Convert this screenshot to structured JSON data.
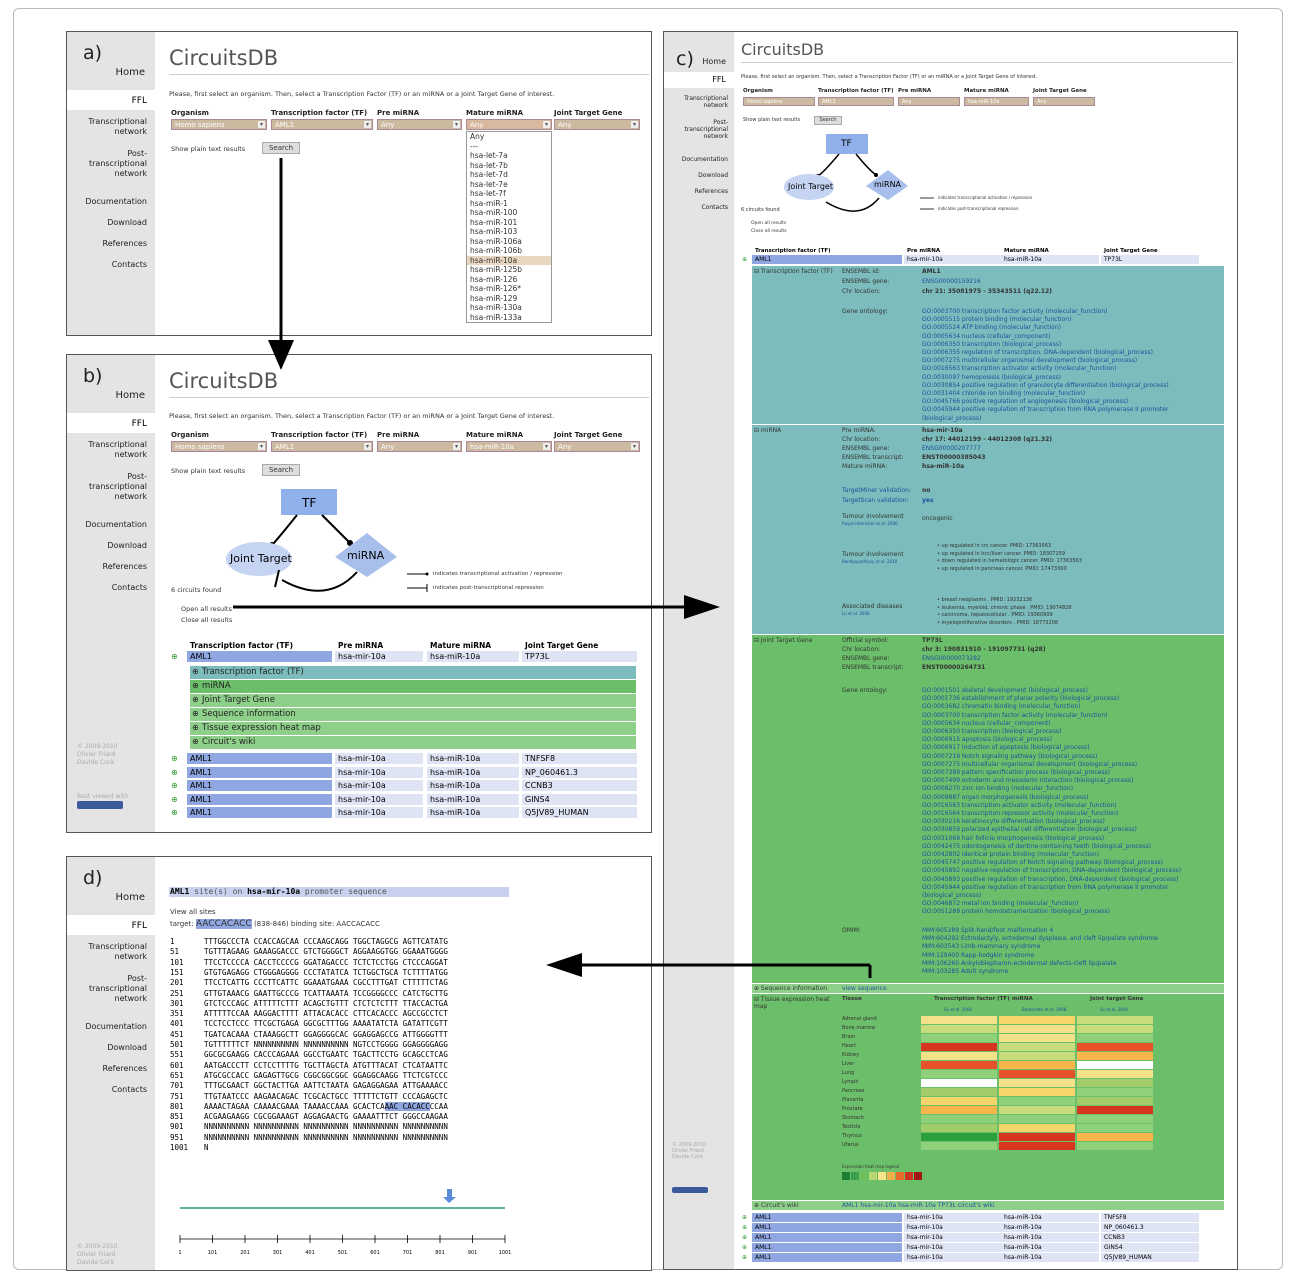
{
  "brand": "CircuitsDB",
  "panels": {
    "a": "a)",
    "b": "b)",
    "c": "c)",
    "d": "d)"
  },
  "nav": {
    "home": "Home",
    "ffl": "FFL",
    "tn": "Transcriptional network",
    "ptn": "Post-transcriptional network",
    "doc": "Documentation",
    "dl": "Download",
    "ref": "References",
    "contacts": "Contacts"
  },
  "intro": "Please, first select an organism. Then, select a Transcription Factor (TF) or an miRNA or a Joint Target Gene of interest.",
  "form": {
    "organism_h": "Organism",
    "tf_h": "Transcription factor (TF)",
    "pre_h": "Pre miRNA",
    "mature_h": "Mature miRNA",
    "jtg_h": "Joint Target Gene",
    "organism": "Homo sapiens",
    "tf": "AML1",
    "pre": "Any",
    "mature_any": "Any",
    "mature_sel": "hsa-miR-10a",
    "jtg": "Any",
    "plain": "Show plain text results",
    "search": "Search"
  },
  "dropdown": [
    "Any",
    "---",
    "hsa-let-7a",
    "hsa-let-7b",
    "hsa-let-7d",
    "hsa-let-7e",
    "hsa-let-7f",
    "hsa-miR-1",
    "hsa-miR-100",
    "hsa-miR-101",
    "hsa-miR-103",
    "hsa-miR-106a",
    "hsa-miR-106b",
    "hsa-miR-10a",
    "hsa-miR-125b",
    "hsa-miR-126",
    "hsa-miR-126*",
    "hsa-miR-129",
    "hsa-miR-130a",
    "hsa-miR-133a"
  ],
  "diagram": {
    "tf": "TF",
    "jt": "Joint Target",
    "mirna": "miRNA",
    "leg1": "indicates transcriptional activation / repression",
    "leg2": "indicates post-transcriptional repression"
  },
  "results": {
    "found": "6 circuits found",
    "open": "Open all results",
    "close": "Close all results",
    "cols": [
      "Transcription factor (TF)",
      "Pre miRNA",
      "Mature miRNA",
      "Joint Target Gene"
    ],
    "first": [
      "AML1",
      "hsa-mir-10a",
      "hsa-miR-10a",
      "TP73L"
    ],
    "sections": [
      "Transcription factor (TF)",
      "miRNA",
      "Joint Target Gene",
      "Sequence information",
      "Tissue expression heat map",
      "Circuit's wiki"
    ],
    "rows": [
      [
        "AML1",
        "hsa-mir-10a",
        "hsa-miR-10a",
        "TNFSF8"
      ],
      [
        "AML1",
        "hsa-mir-10a",
        "hsa-miR-10a",
        "NP_060461.3"
      ],
      [
        "AML1",
        "hsa-mir-10a",
        "hsa-miR-10a",
        "CCNB3"
      ],
      [
        "AML1",
        "hsa-mir-10a",
        "hsa-miR-10a",
        "GINS4"
      ],
      [
        "AML1",
        "hsa-mir-10a",
        "hsa-miR-10a",
        "Q5JV89_HUMAN"
      ]
    ]
  },
  "footer": {
    "copy": "© 2009-2010",
    "a1": "Olivier Friard",
    "a2": "Davide Corà",
    "best": "Best viewed with"
  },
  "detail": {
    "tf_label": "Transcription factor (TF)",
    "tf": [
      [
        "ENSEMBL id:",
        "AML1"
      ],
      [
        "ENSEMBL gene:",
        "ENSG00000159216"
      ],
      [
        "Chr location:",
        "chr 21: 35081975 - 35343511 (q22.12)"
      ]
    ],
    "go_label": "Gene ontology:",
    "tf_go": [
      "GO:0003700 transcription factor activity (molecular_function)",
      "GO:0005515 protein binding (molecular_function)",
      "GO:0005524 ATP binding (molecular_function)",
      "GO:0005634 nucleus (cellular_component)",
      "GO:0006350 transcription (biological_process)",
      "GO:0006355 regulation of transcription, DNA-dependent (biological_process)",
      "GO:0007275 multicellular organismal development (biological_process)",
      "GO:0016563 transcription activator activity (molecular_function)",
      "GO:0030097 hemopoiesis (biological_process)",
      "GO:0030854 positive regulation of granulocyte differentiation (biological_process)",
      "GO:0031404 chloride ion binding (molecular_function)",
      "GO:0045766 positive regulation of angiogenesis (biological_process)",
      "GO:0045944 positive regulation of transcription from RNA polymerase II promoter",
      "(biological_process)"
    ],
    "mi_label": "miRNA",
    "mi": [
      [
        "Pre miRNA:",
        "hsa-mir-10a"
      ],
      [
        "Chr location:",
        "chr 17: 44012199 - 44012308 (q21.32)"
      ],
      [
        "ENSEMBL gene:",
        "ENSG00000207777"
      ],
      [
        "ENSEMBL transcript:",
        "ENST00000385043"
      ],
      [
        "Mature miRNA:",
        "hsa-miR-10a"
      ]
    ],
    "tm": [
      "TargetMiner validation:",
      "no"
    ],
    "ts": [
      "TargetScan validation:",
      "yes"
    ],
    "tumour": "Tumour involvement",
    "onco": "oncogenic",
    "ref1": "Rayani-Kemcher et al. 2006",
    "tumour2": "Tumour involvement",
    "ref2": "Bandyopadhyay et al. 2010",
    "tum_list": [
      "up regulated in crc cancer. PMID: 17363563",
      "up regulated in hcc/liver cancer. PMID: 18307259",
      "down regulated in hematologic cancer. PMID: 17363563",
      "up regulated in pancreas cancer. PMID: 17473300"
    ],
    "assoc": "Associated diseases",
    "ref3": "Lu et al. 2008",
    "dis_list": [
      "breast neoplasms . PMID: 19232136",
      "leukemia, myeloid, chronic phase . PMID: 19074828",
      "carcinoma, hepatocellular . PMID: 19360909",
      "myeloproliferative disorders . PMID: 18773208"
    ],
    "jtg_label": "Joint Target Gene",
    "jtg": [
      [
        "Official symbol:",
        "TP73L"
      ],
      [
        "Chr location:",
        "chr 3: 190831910 - 191097731 (q28)"
      ],
      [
        "ENSEMBL gene:",
        "ENSG00000073282"
      ],
      [
        "ENSEMBL transcript:",
        "ENST00000264731"
      ]
    ],
    "jtg_go": [
      "GO:0001501 skeletal development (biological_process)",
      "GO:0001736 establishment of planar polarity (biological_process)",
      "GO:0003682 chromatin binding (molecular_function)",
      "GO:0003700 transcription factor activity (molecular_function)",
      "GO:0005634 nucleus (cellular_component)",
      "GO:0006350 transcription (biological_process)",
      "GO:0006915 apoptosis (biological_process)",
      "GO:0006917 induction of apoptosis (biological_process)",
      "GO:0007219 Notch signaling pathway (biological_process)",
      "GO:0007275 multicellular organismal development (biological_process)",
      "GO:0007389 pattern specification process (biological_process)",
      "GO:0007499 ectoderm and mesoderm interaction (biological_process)",
      "GO:0008270 zinc ion binding (molecular_function)",
      "GO:0009887 organ morphogenesis (biological_process)",
      "GO:0016563 transcription activator activity (molecular_function)",
      "GO:0016564 transcription repressor activity (molecular_function)",
      "GO:0030216 keratinocyte differentiation (biological_process)",
      "GO:0030859 polarized epithelial cell differentiation (biological_process)",
      "GO:0031069 hair follicle morphogenesis (biological_process)",
      "GO:0042475 odontogenesis of dentine-containing teeth (biological_process)",
      "GO:0042802 identical protein binding (molecular_function)",
      "GO:0045747 positive regulation of Notch signaling pathway (biological_process)",
      "GO:0045892 negative regulation of transcription, DNA-dependent (biological_process)",
      "GO:0045893 positive regulation of transcription, DNA-dependent (biological_process)",
      "GO:0045944 positive regulation of transcription from RNA polymerase II promoter",
      "(biological_process)",
      "GO:0046872 metal ion binding (molecular_function)",
      "GO:0051289 protein homotetramerization (biological_process)"
    ],
    "omim_label": "OMIM:",
    "omim": [
      "MIM:605289 Split-hand/foot malformation 4",
      "MIM:604292 Ectrodactyly, ectodermal dysplasia, and cleft lip/palate syndrome",
      "MIM:603543 Limb-mammary syndrome",
      "MIM:129400 Rapp-hodgkin syndrome",
      "MIM:106260 Ankyloblepharon-ectodermal defects-cleft lip/palate",
      "MIM:103285 Adult syndrome"
    ],
    "seq_label": "Sequence information",
    "seq_link": "view sequence",
    "heat_label": "Tissue expression heat map",
    "heat_cols": [
      "Tissue",
      "Transcription factor (TF)",
      "miRNA",
      "Joint target Gene"
    ],
    "heat_refs": [
      "Su et al. 2004",
      "Barbarotto et al. 2008",
      "Su et al. 2004"
    ],
    "tissues": [
      "Adrenal gland",
      "Bone marrow",
      "Brain",
      "Heart",
      "Kidney",
      "Liver",
      "Lung",
      "Lymph",
      "Pancreas",
      "Placenta",
      "Prostate",
      "Stomach",
      "Testicle",
      "Thymus",
      "Uterus"
    ],
    "heat_legend": "Expression heat map legend",
    "wiki_label": "Circuit's wiki",
    "wiki_link": "AML1 hsa-mir-10a hsa-miR-10a TP73L circuit's wiki"
  },
  "seq": {
    "title_a": "AML1",
    "title_b": "site(s) on",
    "title_c": "hsa-mir-10a",
    "title_d": "promoter sequence",
    "viewall": "View all sites",
    "target_pre": "target:",
    "target_seq": "AACCACACC",
    "target_post": "(838-846) binding site: AACCACACC",
    "lines": [
      [
        "1",
        "TTTGGCCCTA CCACCAGCAA CCCAAGCAGG TGGCTAGGCG AGTTCATATG"
      ],
      [
        "51",
        "TGTTTAGAAG GAAAGGACCC GTCTGGGGCT AGGAAGGTGG GGAAATGGGG"
      ],
      [
        "101",
        "TTCCTCCCCA CACCTCCCCG GGATAGACCC TCTCTCCTGG CTCCCAGGAT"
      ],
      [
        "151",
        "GTGTGAGAGG CTGGGAGGGG CCCTATATCA TCTGGCTGCA TCTTTTATGG"
      ],
      [
        "201",
        "TTCCTCATTG CCCTTCATTC GGAAATGAAA CGCCTTTGAT CTTTTTCTAG"
      ],
      [
        "251",
        "GTTGTAAACG GAATTGCCCG TCATTAAATA TCCGGGGCCC CATCTGCTTG"
      ],
      [
        "301",
        "GTCTCCCAGC ATTTTTCTTT ACAGCTGTTT CTCTCTCTTT TTACCACTGA"
      ],
      [
        "351",
        "ATTTTTCCAA AAGGACTTTT ATTACACACC CTTCACACCC AGCCGCCTCT"
      ],
      [
        "401",
        "TCCTCCTCCC TTCGCTGAGA GGCGCTTTGG AAAATATCTA GATATTCGTT"
      ],
      [
        "451",
        "TGATCACAAA CTAAAGGCTT GGAGGGGCAC GGAGGAGCCG ATTGGGGTTT"
      ],
      [
        "501",
        "TGTTTTTTCT NNNNNNNNNN NNNNNNNNNN NGTCCTGGGG GGAGGGGAGG"
      ],
      [
        "551",
        "GGCGCGAAGG CACCCAGAAA GGCCTGAATC TGACTTCCTG GCAGCCTCAG"
      ],
      [
        "601",
        "AATGACCCTT CCTCCTTTTG TGCTTAGCTA ATGTTTACAT CTCATAATTC"
      ],
      [
        "651",
        "ATGCGCCACC GAGAGTTGCG CGGCGGCGGC GGAGGCAAGG TTCTCGTCCC"
      ],
      [
        "701",
        "TTTGCGAACT GGCTACTTGA AATTCTAATA GAGAGGAGAA ATTGAAAACC"
      ],
      [
        "751",
        "TTGTAATCCC AAGAACAGAC TCGCACTGCC TTTTTCTGTT CCCAGAGCTC"
      ],
      [
        "801",
        "AAAACTAGAA CAAAACGAAA TAAAACCAAA GCACTCAAAC CACACCCCAA"
      ],
      [
        "851",
        "ACGAAGAAGG CGCGGAAAGT AGGAGAACTG GAAAATTTCT GGGCCAAGAA"
      ],
      [
        "901",
        "NNNNNNNNNN NNNNNNNNNN NNNNNNNNNN NNNNNNNNNN NNNNNNNNNN"
      ],
      [
        "951",
        "NNNNNNNNNN NNNNNNNNNN NNNNNNNNNN NNNNNNNNNN NNNNNNNNNN"
      ],
      [
        "1001",
        "N"
      ]
    ],
    "ticks": [
      "1",
      "101",
      "201",
      "301",
      "401",
      "501",
      "601",
      "701",
      "801",
      "901",
      "1001"
    ]
  },
  "colors": {
    "tf_row": "#8fa6e0",
    "row_bg": "#dfe4f5",
    "teal": "#7cbcbc",
    "green": "#6cbf6a",
    "lightgreen": "#8ed08a",
    "tfbox": "#8fb0ea"
  }
}
